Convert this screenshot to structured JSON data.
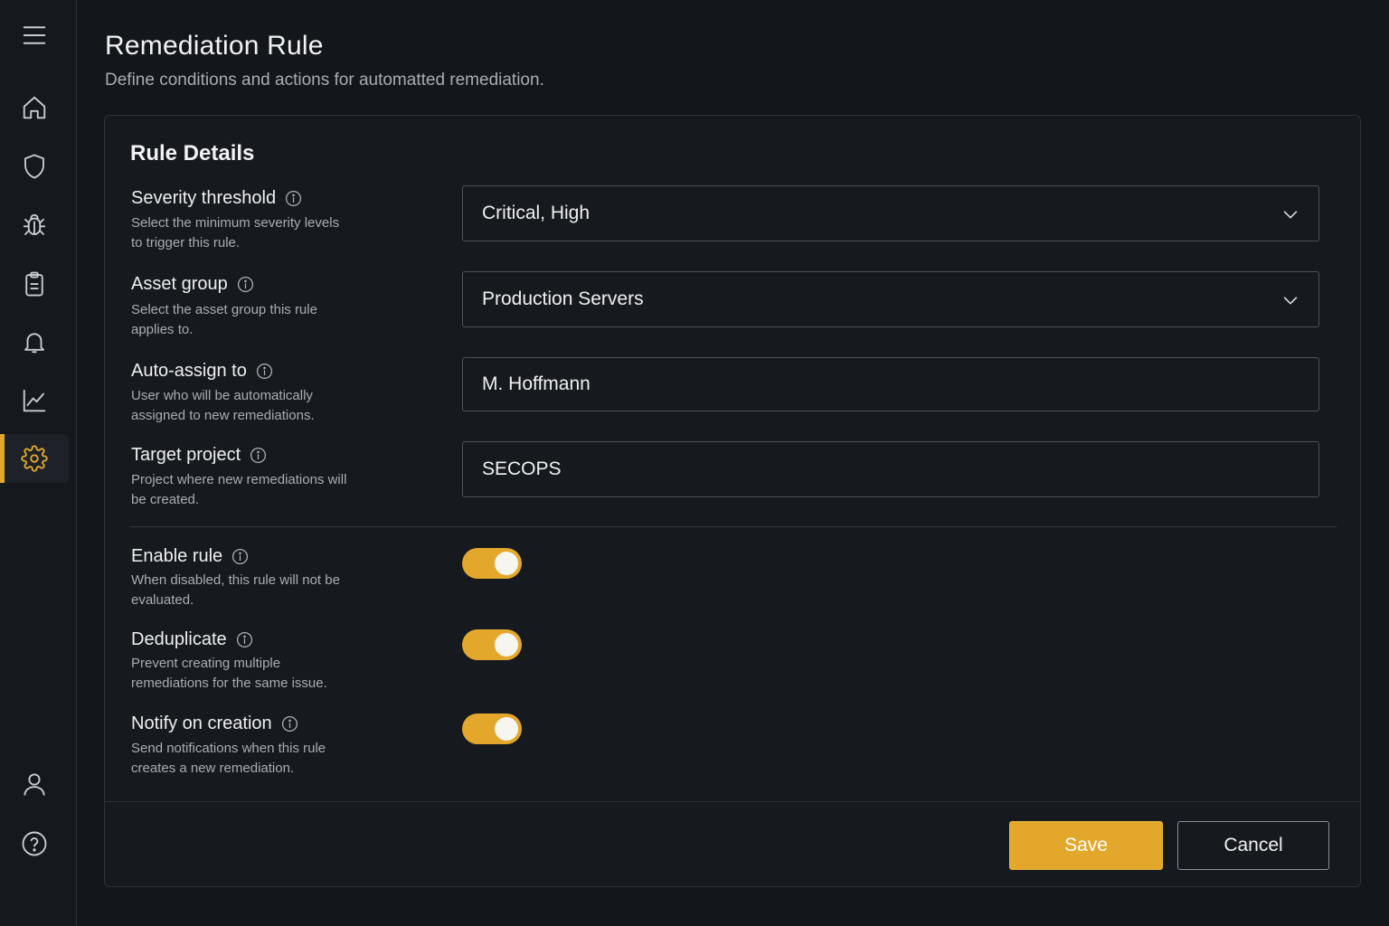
{
  "header": {
    "title": "Remediation Rule",
    "subtitle": "Define conditions and actions for automatted remediation."
  },
  "sidebar": {
    "items": [
      {
        "icon": "menu-icon"
      },
      {
        "icon": "home-icon"
      },
      {
        "icon": "shield-icon"
      },
      {
        "icon": "bug-icon"
      },
      {
        "icon": "clipboard-icon"
      },
      {
        "icon": "bell-icon"
      },
      {
        "icon": "chart-icon"
      },
      {
        "icon": "gear-icon",
        "active": true
      },
      {
        "icon": "user-icon"
      },
      {
        "icon": "help-icon"
      }
    ]
  },
  "card": {
    "title": "Rule Details",
    "fields": [
      {
        "label": "Severity threshold",
        "description": "Select the minimum severity levels to trigger this rule.",
        "value": "Critical, High",
        "type": "select"
      },
      {
        "label": "Asset group",
        "description": "Select the asset group this rule applies to.",
        "value": "Production Servers",
        "type": "select"
      },
      {
        "label": "Auto-assign to",
        "description": "User who will be automatically assigned to new remediations.",
        "value": "M. Hoffmann",
        "type": "text"
      },
      {
        "label": "Target project",
        "description": "Project where new remediations will be created.",
        "value": "SECOPS",
        "type": "text"
      }
    ],
    "toggles": [
      {
        "label": "Enable rule",
        "description": "When disabled, this rule will not be evaluated.",
        "on": true
      },
      {
        "label": "Deduplicate",
        "description": "Prevent creating multiple remediations for the same issue.",
        "on": true
      },
      {
        "label": "Notify on creation",
        "description": "Send notifications when this rule creates a new remediation.",
        "on": true
      }
    ]
  },
  "actions": {
    "save_label": "Save",
    "cancel_label": "Cancel"
  },
  "colors": {
    "accent": "#e3a82b",
    "background": "#13161b",
    "card": "#16191e"
  }
}
